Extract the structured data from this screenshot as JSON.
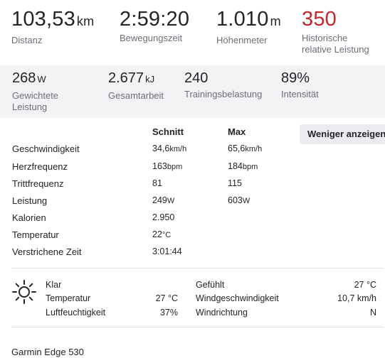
{
  "top_stats": [
    {
      "value": "103,53",
      "unit": "km",
      "label": "Distanz"
    },
    {
      "value": "2:59:20",
      "unit": "",
      "label": "Bewegungszeit"
    },
    {
      "value": "1.010",
      "unit": "m",
      "label": "Höhenmeter"
    },
    {
      "value": "350",
      "unit": "",
      "label_line1": "Historische",
      "label_line2": "relative Leistung",
      "color": "#c1272d"
    }
  ],
  "band_stats": [
    {
      "value": "268",
      "unit": "W",
      "label_line1": "Gewichtete",
      "label_line2": "Leistung"
    },
    {
      "value": "2.677",
      "unit": "kJ",
      "label_line1": "Gesamtarbeit"
    },
    {
      "value": "240",
      "unit": "",
      "label_line1": "Trainingsbelastung"
    },
    {
      "value": "89%",
      "unit": "",
      "label_line1": "Intensität"
    }
  ],
  "table": {
    "col_avg": "Schnitt",
    "col_max": "Max",
    "toggle_label": "Weniger anzeigen",
    "rows": [
      {
        "label": "Geschwindigkeit",
        "avg": "34,6",
        "avg_unit": "km/h",
        "max": "65,6",
        "max_unit": "km/h"
      },
      {
        "label": "Herzfrequenz",
        "avg": "163",
        "avg_unit": "bpm",
        "max": "184",
        "max_unit": "bpm"
      },
      {
        "label": "Trittfrequenz",
        "avg": "81",
        "avg_unit": "",
        "max": "115",
        "max_unit": ""
      },
      {
        "label": "Leistung",
        "avg": "249",
        "avg_unit": "W",
        "max": "603",
        "max_unit": "W"
      },
      {
        "label": "Kalorien",
        "avg": "2.950",
        "avg_unit": "",
        "max": "",
        "max_unit": ""
      },
      {
        "label": "Temperatur",
        "avg": "22",
        "avg_unit": "°C",
        "max": "",
        "max_unit": ""
      },
      {
        "label": "Verstrichene Zeit",
        "avg": "3:01:44",
        "avg_unit": "",
        "max": "",
        "max_unit": ""
      }
    ]
  },
  "weather": {
    "icon": "sun-icon",
    "condition": "Klar",
    "temp_label": "Temperatur",
    "temp_value": "27 °C",
    "humidity_label": "Luftfeuchtigkeit",
    "humidity_value": "37%",
    "feels_label": "Gefühlt",
    "feels_value": "27 °C",
    "wind_speed_label": "Windgeschwindigkeit",
    "wind_speed_value": "10,7 km/h",
    "wind_dir_label": "Windrichtung",
    "wind_dir_value": "N"
  },
  "device": "Garmin Edge 530"
}
